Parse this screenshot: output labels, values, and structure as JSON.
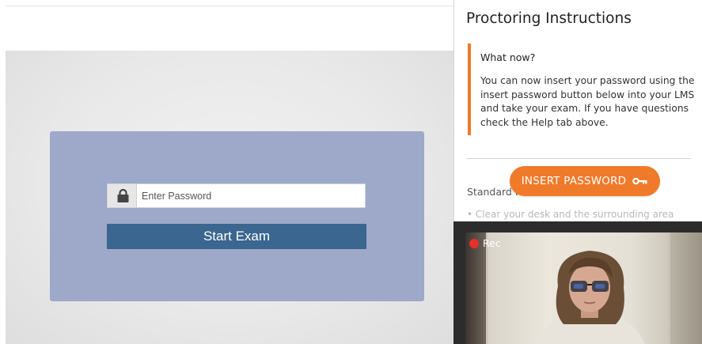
{
  "exam": {
    "password_placeholder": "Enter Password",
    "start_button_label": "Start Exam"
  },
  "proctoring": {
    "title": "Proctoring Instructions",
    "callout_heading": "What now?",
    "callout_text": "You can now insert your password using the insert password button below into your LMS and take your exam. If you have questions check the Help tab above.",
    "standard_label": "Standard R",
    "insert_password_label": "INSERT PASSWORD",
    "faded_bullet": "• Clear your desk and the surrounding area"
  },
  "webcam": {
    "rec_label": "Rec"
  },
  "colors": {
    "accent_orange": "#ef7a2a",
    "card_blue": "#9ea8c9",
    "button_blue": "#3a6690",
    "rec_red": "#e5302b"
  },
  "icons": [
    "lock-icon",
    "key-icon",
    "record-dot-icon"
  ]
}
